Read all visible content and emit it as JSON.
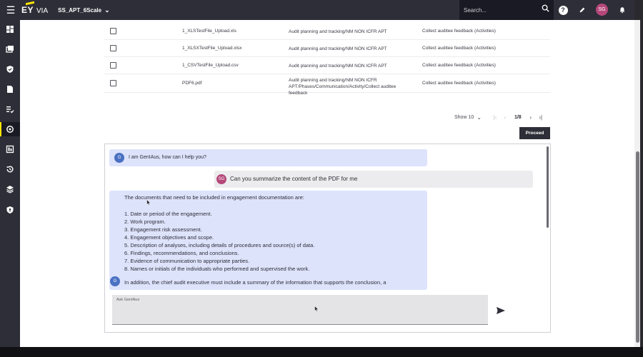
{
  "header": {
    "logo_ey": "EY",
    "logo_via": "VIA",
    "project": "SS_APT_6Scale",
    "search_placeholder": "Search...",
    "user_initials": "SG",
    "help_glyph": "?"
  },
  "sidebar": {
    "icons": [
      "dashboard-icon",
      "engagements-icon",
      "shield-icon",
      "documents-icon",
      "tasks-icon",
      "genaus-icon",
      "reports-icon",
      "history-icon",
      "layers-icon",
      "security-icon"
    ],
    "active_index": 5
  },
  "files": [
    {
      "name": "1_XLSTestFile_Upload.xls",
      "path": "Audit planning and tracking/NM NON ICFR APT",
      "activity": "Collect auditee feedback (Activities)"
    },
    {
      "name": "1_XLSXTestFile_Upload.xlsx",
      "path": "Audit planning and tracking/NM NON ICFR APT",
      "activity": "Collect auditee feedback (Activities)"
    },
    {
      "name": "1_CSVTestFile_Upload.csv",
      "path": "Audit planning and tracking/NM NON ICFR APT",
      "activity": "Collect auditee feedback (Activities)"
    },
    {
      "name": "PDF6.pdf",
      "path": "Audit planning and tracking/NM NON ICFR APT/Phases/Communication/Activity/Collect auditee feedback",
      "activity": "Collect auditee feedback (Activities)"
    }
  ],
  "pagination": {
    "show_label": "Show 10",
    "page": "1/8"
  },
  "proceed_label": "Proceed",
  "chat": {
    "bot_initial": "G",
    "user_initials": "SG",
    "greeting": "I am GenIAus, how can I help you?",
    "user_message": "Can you summarize the content of the PDF for me",
    "response_intro": "The documents that need to be included in engagement documentation are:",
    "response_items": [
      "1. Date or period of the engagement.",
      "2. Work program.",
      "3. Engagement risk assessment.",
      "4. Engagement objectives and scope.",
      "5. Description of analyses, including details of procedures and source(s) of data.",
      "6. Findings, recommendations, and conclusions.",
      "7. Evidence of communication to appropriate parties.",
      "8. Names or initials of the individuals who performed and supervised the work."
    ],
    "response_outro": "In addition, the chief audit executive must include a summary of the information that supports the conclusion, a",
    "input_label": "Ask GenIAus"
  }
}
